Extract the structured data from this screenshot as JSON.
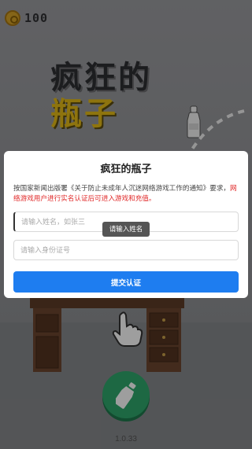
{
  "hud": {
    "coins": "100",
    "coin_icon": "coin-icon"
  },
  "logo": {
    "line1": "疯狂的",
    "line2": "瓶子"
  },
  "dialog": {
    "title": "疯狂的瓶子",
    "notice_normal": "按国家新闻出版署《关于防止未成年人沉迷网络游戏工作的通知》要求，",
    "notice_warning": "网络游戏用户进行实名认证后可进入游戏和充值。",
    "name_placeholder": "请输入姓名，如张三",
    "id_placeholder": "请输入身份证号",
    "submit_label": "提交认证"
  },
  "toast": {
    "text": "请输入姓名"
  },
  "footer": {
    "version": "1.0.33"
  },
  "colors": {
    "accent": "#1e7df0",
    "warning": "#e02828",
    "play": "#2fa96d",
    "logo_yellow": "#e6bb18"
  }
}
